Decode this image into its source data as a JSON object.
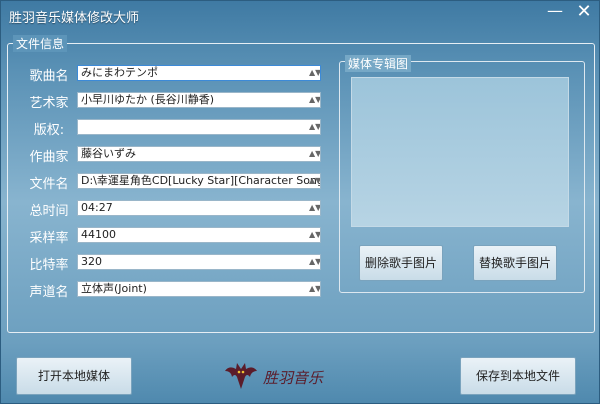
{
  "window": {
    "title": "胜羽音乐媒体修改大师"
  },
  "titlebar": {
    "minimize_glyph": "—",
    "close_glyph": "✕"
  },
  "file_info": {
    "legend": "文件信息",
    "fields": [
      {
        "label": "歌曲名",
        "value": "みにまわテンポ"
      },
      {
        "label": "艺术家",
        "value": "小早川ゆたか (長谷川静香)"
      },
      {
        "label": "版权:",
        "value": ""
      },
      {
        "label": "作曲家",
        "value": "藤谷いずみ"
      },
      {
        "label": "文件名",
        "value": "D:\\幸運星角色CD[Lucky Star][Character Song V"
      },
      {
        "label": "总时间",
        "value": "04:27"
      },
      {
        "label": "采样率",
        "value": "44100"
      },
      {
        "label": "比特率",
        "value": "320"
      },
      {
        "label": "声道名",
        "value": "立体声(Joint)"
      }
    ]
  },
  "album": {
    "legend": "媒体专辑图",
    "delete_label": "删除歌手图片",
    "replace_label": "替换歌手图片"
  },
  "footer": {
    "open_label": "打开本地媒体",
    "save_label": "保存到本地文件",
    "logo_text": "胜羽音乐"
  },
  "colors": {
    "window_bg": "#6c9fbf",
    "active_border": "#3c8ad8",
    "logo_color": "#5b1c2a"
  },
  "icons": {
    "dropdown": "dropdown-arrow-icon",
    "logo": "bat-logo-icon"
  }
}
